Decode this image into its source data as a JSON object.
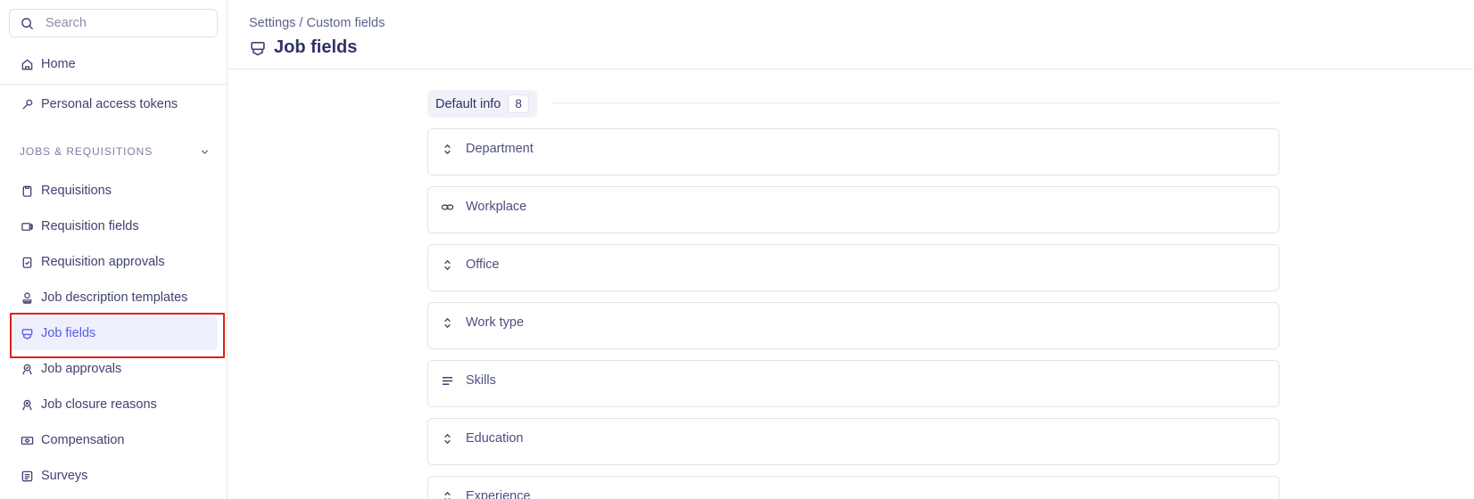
{
  "sidebar": {
    "search_placeholder": "Search",
    "home_label": "Home",
    "tokens_label": "Personal access tokens",
    "section_title": "JOBS & REQUISITIONS",
    "items": [
      {
        "label": "Requisitions",
        "icon": "clipboard-icon"
      },
      {
        "label": "Requisition fields",
        "icon": "tag-icon"
      },
      {
        "label": "Requisition approvals",
        "icon": "clipboard-check-icon"
      },
      {
        "label": "Job description templates",
        "icon": "stamp-icon"
      },
      {
        "label": "Job fields",
        "icon": "job-fields-icon",
        "active": true
      },
      {
        "label": "Job approvals",
        "icon": "approval-badge-icon"
      },
      {
        "label": "Job closure reasons",
        "icon": "closure-badge-icon"
      },
      {
        "label": "Compensation",
        "icon": "money-icon"
      },
      {
        "label": "Surveys",
        "icon": "survey-icon"
      }
    ]
  },
  "header": {
    "breadcrumb": "Settings / Custom fields",
    "title": "Job fields"
  },
  "main": {
    "group": {
      "label": "Default info",
      "count": "8"
    },
    "fields": [
      {
        "name": "Department",
        "icon": "select-chevrons-icon"
      },
      {
        "name": "Workplace",
        "icon": "link-icon"
      },
      {
        "name": "Office",
        "icon": "select-chevrons-icon"
      },
      {
        "name": "Work type",
        "icon": "select-chevrons-icon"
      },
      {
        "name": "Skills",
        "icon": "text-lines-icon"
      },
      {
        "name": "Education",
        "icon": "select-chevrons-icon"
      },
      {
        "name": "Experience",
        "icon": "select-chevrons-icon"
      }
    ]
  },
  "colors": {
    "accent": "#5b5be6",
    "active_bg": "#eef0fd",
    "highlight": "#e0201e"
  }
}
